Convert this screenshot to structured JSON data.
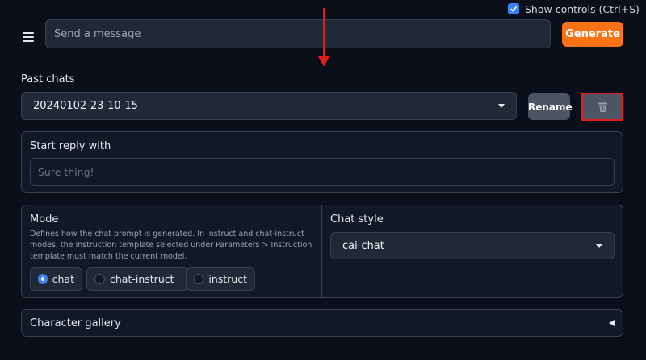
{
  "header": {
    "show_controls_label": "Show controls (Ctrl+S)",
    "show_controls_checked": true,
    "message_placeholder": "Send a message",
    "generate_label": "Generate"
  },
  "past_chats": {
    "label": "Past chats",
    "selected": "20240102-23-10-15",
    "rename_label": "Rename"
  },
  "start_reply": {
    "label": "Start reply with",
    "placeholder": "Sure thing!"
  },
  "mode": {
    "label": "Mode",
    "description": "Defines how the chat prompt is generated. In instruct and chat-instruct modes, the instruction template selected under Parameters > Instruction template must match the current model.",
    "options": [
      {
        "label": "chat",
        "selected": true
      },
      {
        "label": "chat-instruct",
        "selected": false
      },
      {
        "label": "instruct",
        "selected": false
      }
    ]
  },
  "chat_style": {
    "label": "Chat style",
    "selected": "cai-chat"
  },
  "character_gallery": {
    "label": "Character gallery"
  },
  "colors": {
    "accent": "#f97316",
    "highlight": "#e11d1d",
    "check": "#3b82f6"
  }
}
